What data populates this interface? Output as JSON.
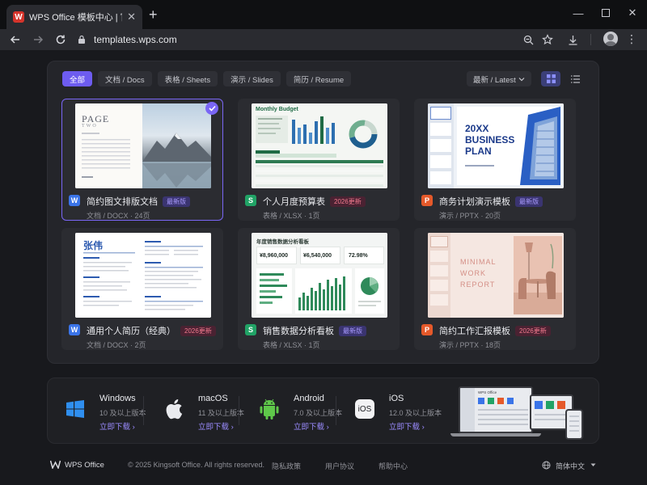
{
  "browser": {
    "tab_title": "WPS Office 模板中心 | 官方模板",
    "url": "templates.wps.com"
  },
  "filters": [
    "全部",
    "文档 / Docs",
    "表格 / Sheets",
    "演示 / Slides",
    "简历 / Resume"
  ],
  "sort": {
    "label": "最新 / Latest"
  },
  "templates": [
    {
      "name": "简约图文排版文档",
      "badge": "最新版",
      "badge_type": "new",
      "type_icon": "W",
      "meta": "文档 / DOCX  ·  24页",
      "color": "#3a74e8",
      "selected": true
    },
    {
      "name": "个人月度预算表",
      "badge": "2026更新",
      "badge_type": "upd",
      "type_icon": "S",
      "meta": "表格 / XLSX  ·  1页",
      "color": "#21a366",
      "selected": false
    },
    {
      "name": "商务计划演示模板",
      "badge": "最新版",
      "badge_type": "new",
      "type_icon": "P",
      "meta": "演示 / PPTX  ·  20页",
      "color": "#e5592a",
      "selected": false
    },
    {
      "name": "通用个人简历（经典）",
      "badge": "2026更新",
      "badge_type": "upd",
      "type_icon": "W",
      "meta": "文档 / DOCX  ·  2页",
      "color": "#3a74e8",
      "selected": false
    },
    {
      "name": "销售数据分析看板",
      "badge": "最新版",
      "badge_type": "new",
      "type_icon": "S",
      "meta": "表格 / XLSX  ·  1页",
      "color": "#21a366",
      "selected": false
    },
    {
      "name": "简约工作汇报模板",
      "badge": "2026更新",
      "badge_type": "upd",
      "type_icon": "P",
      "meta": "演示 / PPTX  ·  18页",
      "color": "#e5592a",
      "selected": false
    }
  ],
  "thumbnails": {
    "doc": {
      "title": "PAGE",
      "subtitle": "TWO"
    },
    "budget": {
      "title": "Monthly Budget"
    },
    "business": {
      "year": "20XX",
      "line1": "BUSINESS",
      "line2": "PLAN"
    },
    "resume": {
      "name": "张伟"
    },
    "sales": {
      "title": "年度销售数据分析看板",
      "kpi1": "¥8,960,000",
      "kpi2": "¥6,540,000",
      "kpi3": "72.98%"
    },
    "report": {
      "line1": "MINIMAL",
      "line2": "WORK",
      "line3": "REPORT"
    }
  },
  "platforms": [
    {
      "name": "Windows",
      "req": "10 及以上版本",
      "link": "立即下载  ›",
      "icon": "windows-icon"
    },
    {
      "name": "macOS",
      "req": "11 及以上版本",
      "link": "立即下载  ›",
      "icon": "apple-icon"
    },
    {
      "name": "Android",
      "req": "7.0 及以上版本",
      "link": "立即下载  ›",
      "icon": "android-icon"
    },
    {
      "name": "iOS",
      "req": "12.0 及以上版本",
      "link": "立即下载  ›",
      "icon": "ios-icon"
    }
  ],
  "devices_preview": {
    "app_label": "WPS Office"
  },
  "footer": {
    "brand": "WPS Office",
    "copyright": "© 2025 Kingsoft Office. All rights reserved.",
    "privacy": "隐私政策",
    "agreement": "用户协议",
    "help": "帮助中心",
    "language": "简体中文"
  }
}
